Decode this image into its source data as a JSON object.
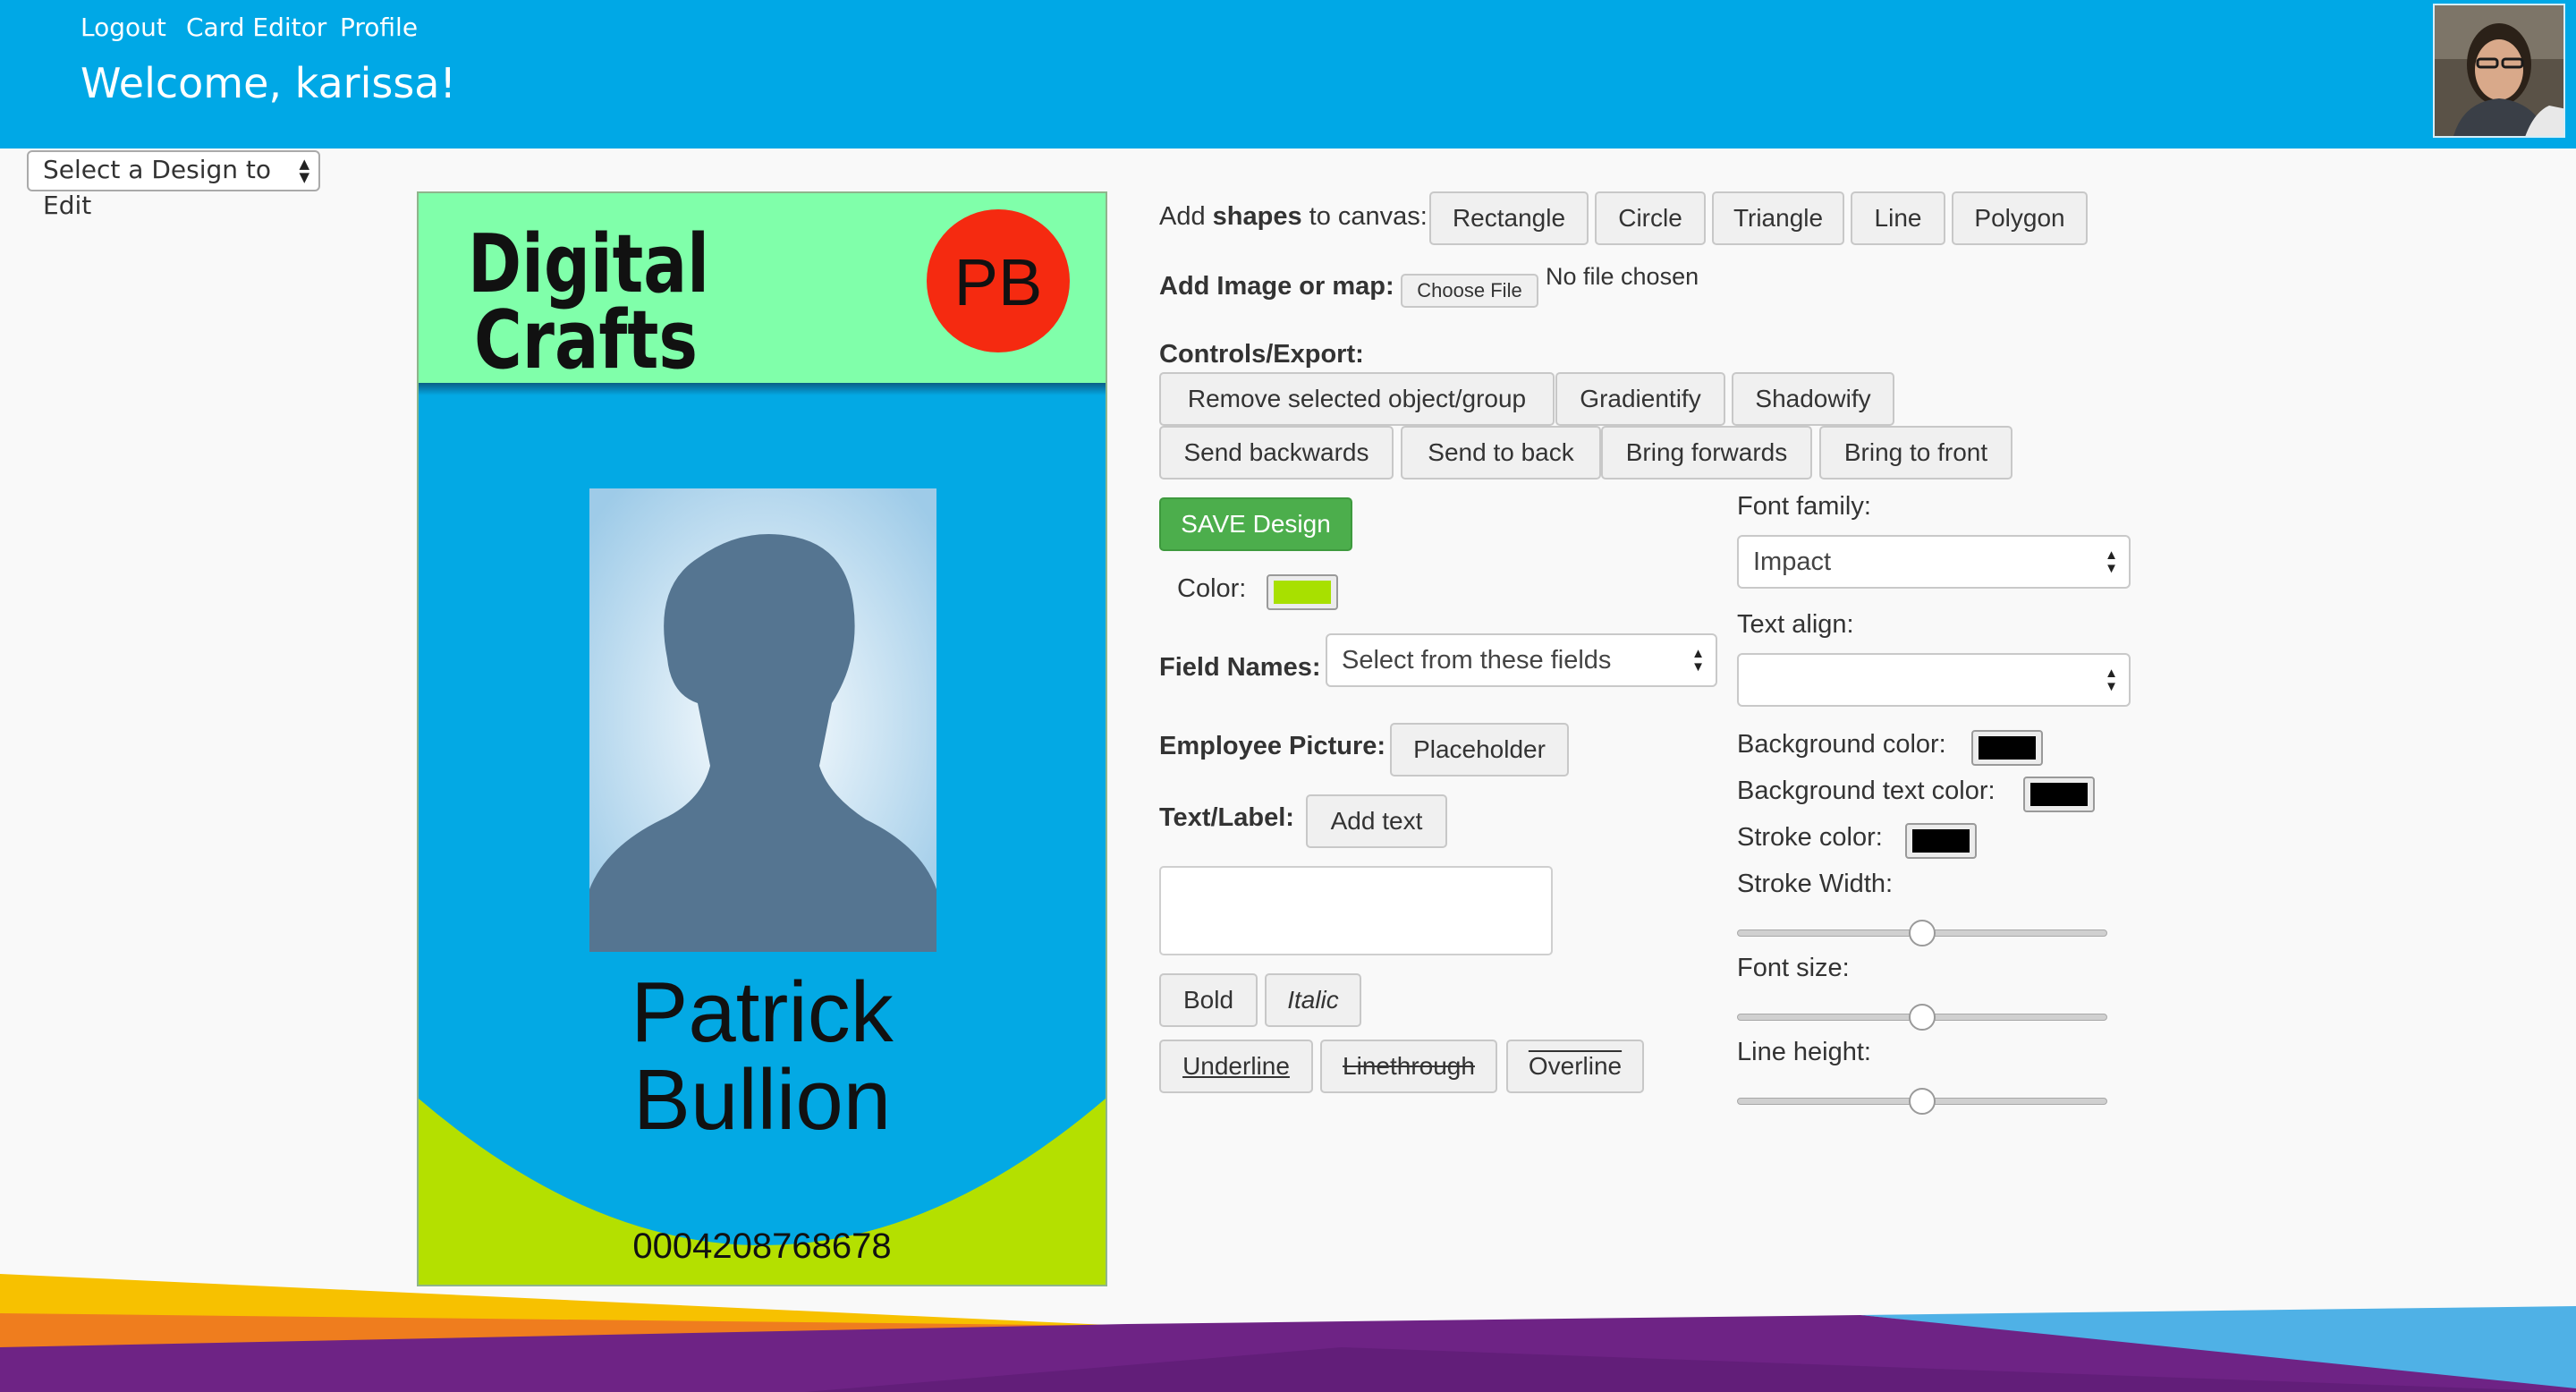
{
  "header": {
    "nav": [
      "Logout",
      "Card Editor",
      "Profile"
    ],
    "welcome": "Welcome, karissa!"
  },
  "design_select": "Select a Design to Edit",
  "card": {
    "logo_line1": "Digital",
    "logo_line2": "Crafts",
    "initials": "PB",
    "first_name": "Patrick",
    "last_name": "Bullion",
    "id_number": "0004208768678",
    "colors": {
      "header": "#80ffaa",
      "body": "#03a9e4",
      "bottom": "#b4e000",
      "badge": "#f52a10"
    }
  },
  "shapes": {
    "label_pre": "Add ",
    "label_bold": "shapes",
    "label_post": " to canvas:",
    "buttons": [
      "Rectangle",
      "Circle",
      "Triangle",
      "Line",
      "Polygon"
    ]
  },
  "image": {
    "label": "Add Image or map:",
    "choose": "Choose File",
    "status": "No file chosen"
  },
  "controls": {
    "label": "Controls/Export:",
    "buttons": [
      "Remove selected object/group",
      "Gradientify",
      "Shadowify",
      "Send backwards",
      "Send to back",
      "Bring forwards",
      "Bring to front"
    ]
  },
  "save": "SAVE Design",
  "color": {
    "label": "Color:",
    "value": "#a8e000"
  },
  "field_names": {
    "label": "Field Names:",
    "value": "Select from these fields"
  },
  "employee_picture": {
    "label": "Employee Picture:",
    "button": "Placeholder"
  },
  "text_label": {
    "label": "Text/Label:",
    "button": "Add text"
  },
  "format_buttons": [
    "Bold",
    "Italic",
    "Underline",
    "Linethrough",
    "Overline"
  ],
  "font_family": {
    "label": "Font family:",
    "value": "Impact"
  },
  "text_align": {
    "label": "Text align:",
    "value": ""
  },
  "bg_color": {
    "label": "Background color:",
    "value": "#000000"
  },
  "bg_text_color": {
    "label": "Background text color:",
    "value": "#000000"
  },
  "stroke_color": {
    "label": "Stroke color:",
    "value": "#000000"
  },
  "sliders": [
    {
      "label": "Stroke Width:",
      "value": 0.5
    },
    {
      "label": "Font size:",
      "value": 0.5
    },
    {
      "label": "Line height:",
      "value": 0.5
    }
  ]
}
